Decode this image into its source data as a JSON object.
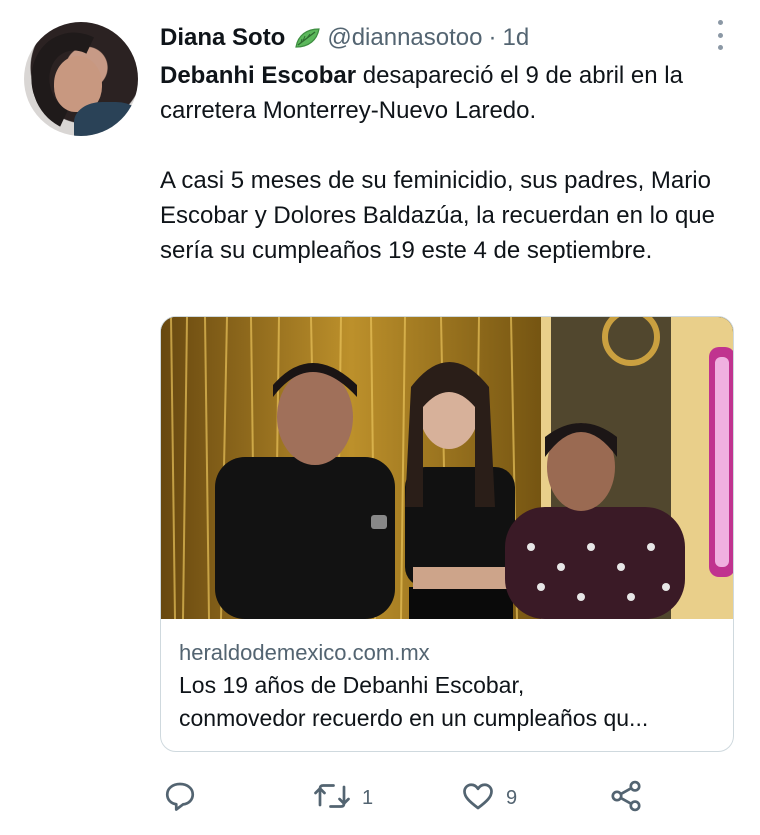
{
  "tweet": {
    "author_name": "Diana Soto",
    "handle": "@diannasotoo",
    "separator": "·",
    "time": "1d",
    "mention": "Debanhi Escobar",
    "line1_rest": " desapareció el 9 de abril en la carretera Monterrey-Nuevo Laredo.",
    "paragraph2": "A casi 5 meses de su feminicidio, sus padres, Mario Escobar y Dolores Baldazúa, la recuerdan en lo que sería su cumpleaños 19 este 4 de septiembre."
  },
  "card": {
    "domain": "heraldodemexico.com.mx",
    "title_line1": "Los 19 años de Debanhi Escobar,",
    "title_line2": "conmovedor recuerdo en un cumpleaños qu..."
  },
  "actions": {
    "reply_icon": "reply-icon",
    "retweet_icon": "retweet-icon",
    "retweet_count": "1",
    "like_icon": "heart-icon",
    "like_count": "9",
    "share_icon": "share-icon"
  },
  "colors": {
    "text": "#0f1419",
    "secondary": "#536471",
    "border": "#cfd9de",
    "leaf": "#4caf50"
  }
}
